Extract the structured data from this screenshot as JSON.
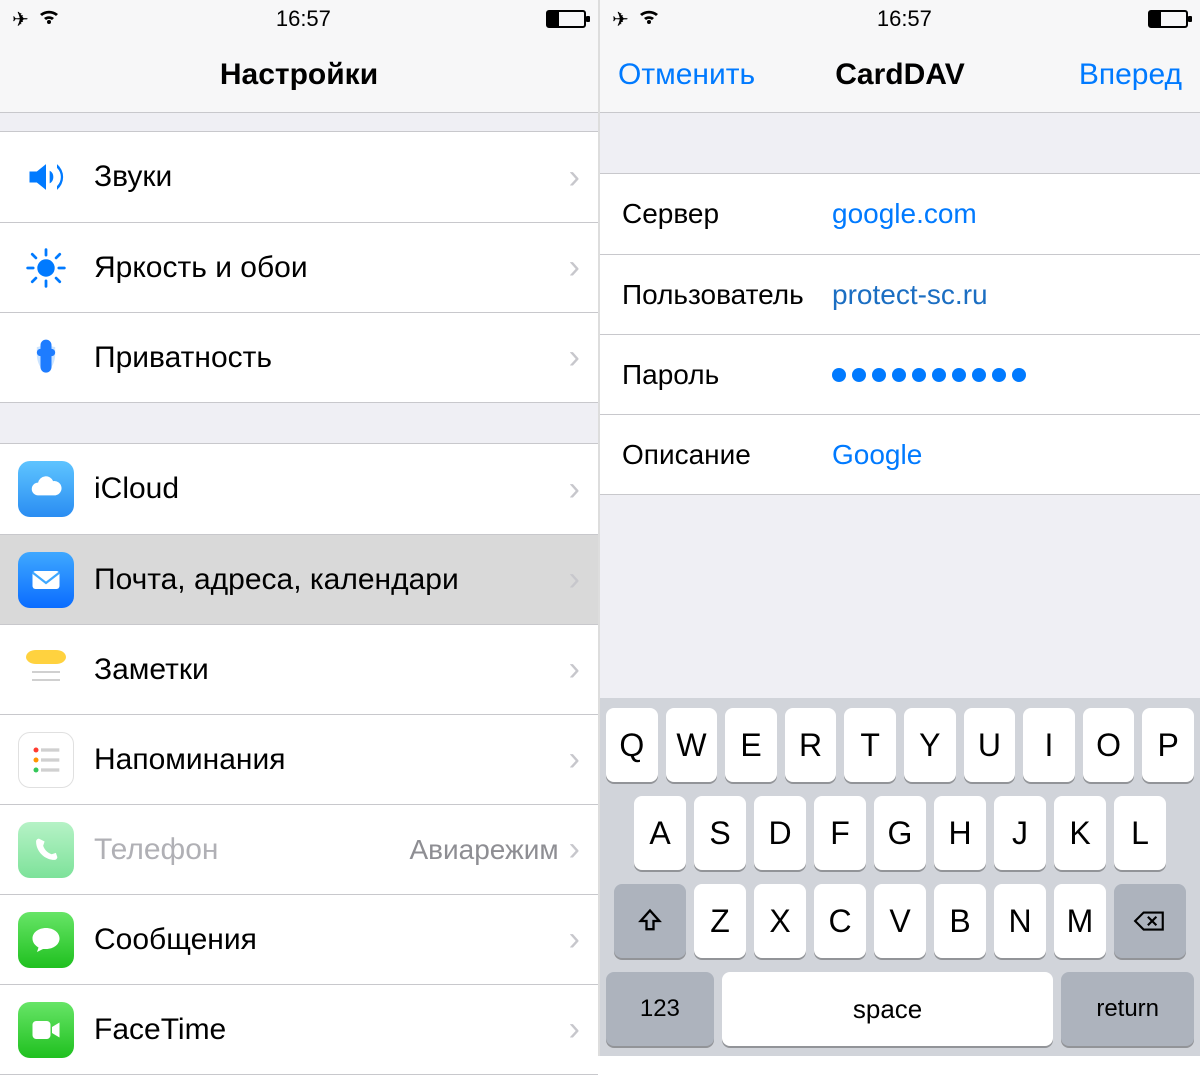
{
  "status": {
    "time": "16:57"
  },
  "accent": "#007aff",
  "left": {
    "title": "Настройки",
    "group1": [
      {
        "icon": "sound-icon",
        "app_icon": false,
        "label": "Звуки"
      },
      {
        "icon": "brightness-icon",
        "app_icon": false,
        "label": "Яркость и обои"
      },
      {
        "icon": "privacy-icon",
        "app_icon": false,
        "label": "Приватность"
      }
    ],
    "group2": [
      {
        "icon": "icloud-icon",
        "label": "iCloud"
      },
      {
        "icon": "mail-icon",
        "label": "Почта, адреса, календари",
        "selected": true
      },
      {
        "icon": "notes-icon",
        "label": "Заметки"
      },
      {
        "icon": "reminders-icon",
        "label": "Напоминания"
      },
      {
        "icon": "phone-icon",
        "label": "Телефон",
        "value": "Авиарежим",
        "disabled": true
      },
      {
        "icon": "messages-icon",
        "label": "Сообщения"
      },
      {
        "icon": "facetime-icon",
        "label": "FaceTime"
      }
    ]
  },
  "right": {
    "cancel": "Отменить",
    "title": "CardDAV",
    "next": "Вперед",
    "fields": {
      "server_label": "Сервер",
      "server_value": "google.com",
      "user_label": "Пользователь",
      "user_value": "protect-sc.ru",
      "password_label": "Пароль",
      "password_dots": 10,
      "desc_label": "Описание",
      "desc_value": "Google"
    },
    "keyboard": {
      "row1": [
        "Q",
        "W",
        "E",
        "R",
        "T",
        "Y",
        "U",
        "I",
        "O",
        "P"
      ],
      "row2": [
        "A",
        "S",
        "D",
        "F",
        "G",
        "H",
        "J",
        "K",
        "L"
      ],
      "row3": [
        "Z",
        "X",
        "C",
        "V",
        "B",
        "N",
        "M"
      ],
      "mode": "123",
      "space": "space",
      "return": "return"
    }
  }
}
